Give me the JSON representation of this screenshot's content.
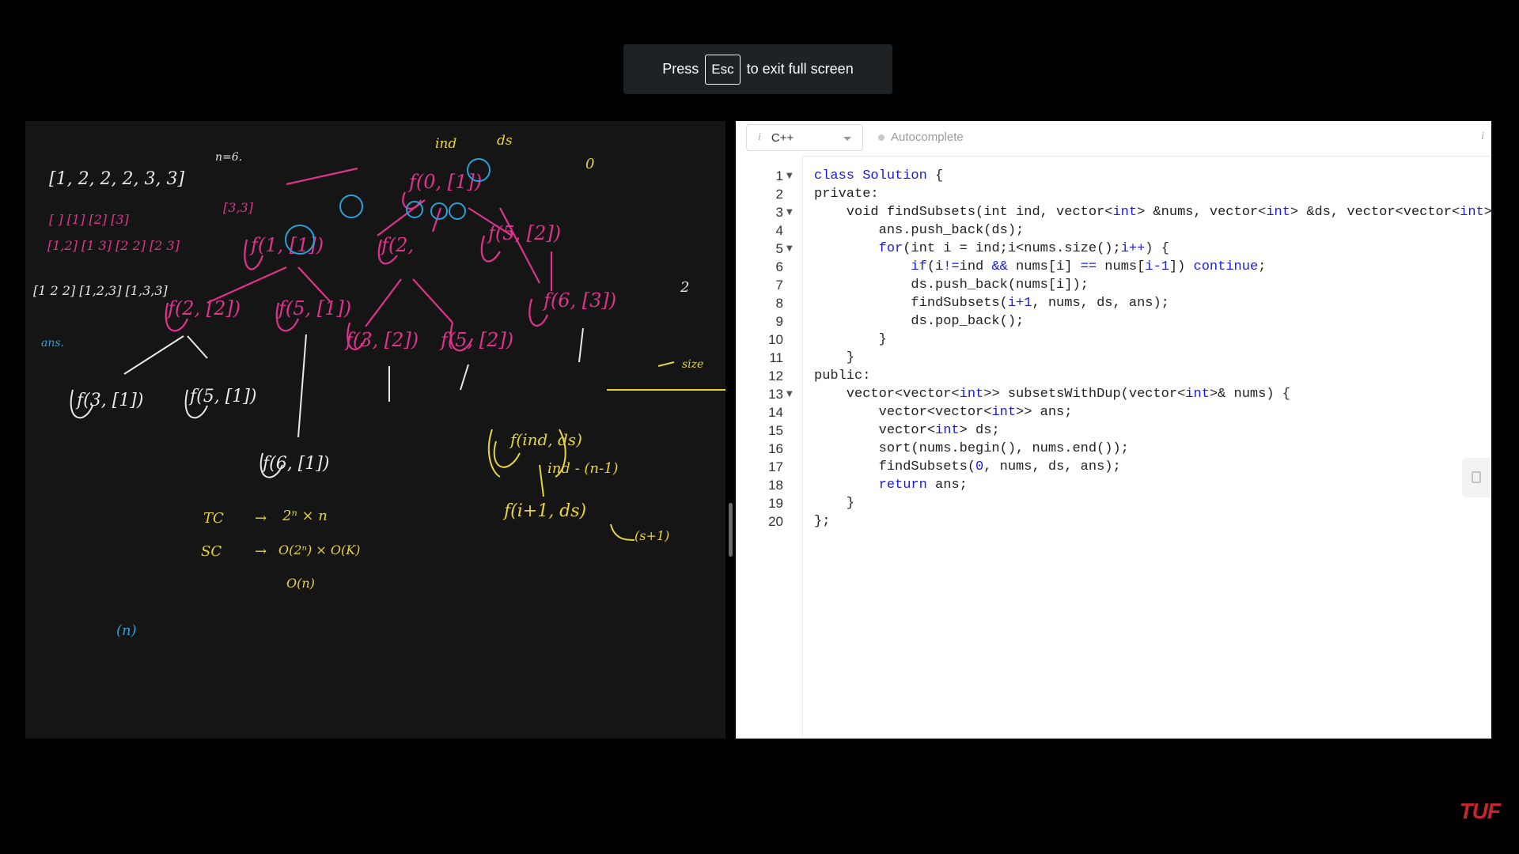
{
  "banner": {
    "press": "Press",
    "key": "Esc",
    "rest": "to exit full screen"
  },
  "editor": {
    "language": "C++",
    "autocomplete_label": "Autocomplete",
    "info_glyph": "i",
    "code_lines": [
      "class Solution {",
      "private:",
      "    void findSubsets(int ind, vector<int> &nums, vector<int> &ds, vector<vector<int>>",
      "        ans.push_back(ds);",
      "        for(int i = ind;i<nums.size();i++) {",
      "            if(i!=ind && nums[i] == nums[i-1]) continue;",
      "            ds.push_back(nums[i]);",
      "            findSubsets(i+1, nums, ds, ans);",
      "            ds.pop_back();",
      "        }",
      "    }",
      "public:",
      "    vector<vector<int>> subsetsWithDup(vector<int>& nums) {",
      "        vector<vector<int>> ans;",
      "        vector<int> ds;",
      "        sort(nums.begin(), nums.end());",
      "        findSubsets(0, nums, ds, ans);",
      "        return ans;",
      "    }",
      "};"
    ],
    "fold_lines": [
      1,
      3,
      5,
      13
    ]
  },
  "whiteboard": {
    "array": "[1, 2, 2, 2, 3, 3]",
    "n_label": "n=6.",
    "ind_label": "ind",
    "ds_label": "ds",
    "tc_label": "TC",
    "tc_value": "2ⁿ × n",
    "sc_label": "SC",
    "sc_value": "O(2ⁿ) × O(K)",
    "sc_aux": "O(n)",
    "n_paren": "(n)",
    "formula": "ind - (n-1)",
    "call": "f(i+1, ds)",
    "s_plus_one": "(s+1)",
    "size_label": "size",
    "zero": "0",
    "two": "2",
    "ans_label": "ans."
  },
  "watermark": "TUF",
  "colors": {
    "pink": "#e0338c",
    "yellow": "#e8d53a",
    "blue": "#2e9fd8",
    "white": "#e8e8e8"
  }
}
